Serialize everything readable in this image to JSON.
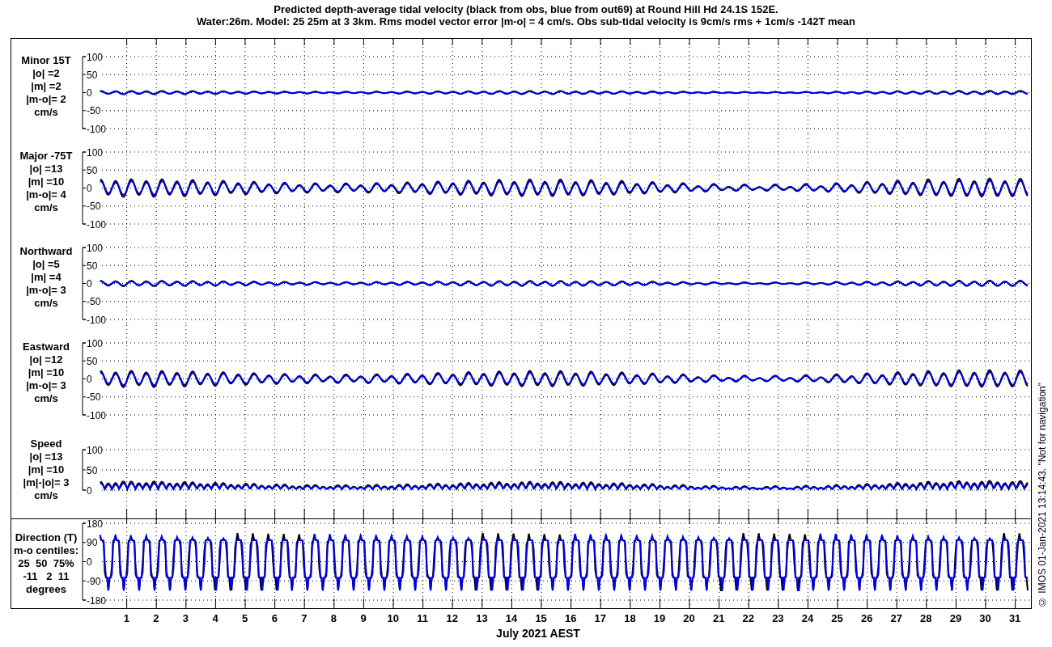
{
  "title": [
    "Predicted depth-average tidal velocity (black from obs, blue from out69) at Round Hill Hd 24.1S 152E.",
    "Water:26m. Model: 25 25m at 3 3km. Rms model vector error |m-o| = 4 cm/s. Obs sub-tidal velocity is 9cm/s rms + 1cm/s -142T mean"
  ],
  "panels": [
    {
      "kind": "velocity",
      "label": [
        "Minor 15T",
        "|o| =2",
        "|m| =2",
        "|m-o|= 2",
        "cm/s"
      ],
      "yticks": [
        "100",
        "50",
        "0",
        "-50",
        "-100"
      ]
    },
    {
      "kind": "velocity",
      "label": [
        "Major -75T",
        "|o| =13",
        "|m| =10",
        "|m-o|= 4",
        "cm/s"
      ],
      "yticks": [
        "100",
        "50",
        "0",
        "-50",
        "-100"
      ]
    },
    {
      "kind": "velocity",
      "label": [
        "Northward",
        "|o| =5",
        "|m| =4",
        "|m-o|= 3",
        "cm/s"
      ],
      "yticks": [
        "100",
        "50",
        "0",
        "-50",
        "-100"
      ]
    },
    {
      "kind": "velocity",
      "label": [
        "Eastward",
        "|o| =12",
        "|m| =10",
        "|m-o|= 3",
        "cm/s"
      ],
      "yticks": [
        "100",
        "50",
        "0",
        "-50",
        "-100"
      ]
    },
    {
      "kind": "speed",
      "label": [
        "Speed",
        "|o| =13",
        "|m| =10",
        "|m|-|o|= 3",
        "cm/s"
      ],
      "yticks": [
        "100",
        "50",
        "0"
      ]
    },
    {
      "kind": "direction",
      "label": [
        "Direction (T)",
        "m-o centiles:",
        "25  50  75%",
        "-11   2  11",
        "degrees"
      ],
      "yticks": [
        "180",
        "90",
        "0",
        "-90",
        "-180"
      ]
    }
  ],
  "days": [
    "1",
    "2",
    "3",
    "4",
    "5",
    "6",
    "7",
    "8",
    "9",
    "10",
    "11",
    "12",
    "13",
    "14",
    "15",
    "16",
    "17",
    "18",
    "19",
    "20",
    "21",
    "22",
    "23",
    "24",
    "25",
    "26",
    "27",
    "28",
    "29",
    "30",
    "31"
  ],
  "xlabel": "July 2021 AEST",
  "credit": "© IMOS 01-Jan-2021 13:14:43. \"Not for navigation\""
}
